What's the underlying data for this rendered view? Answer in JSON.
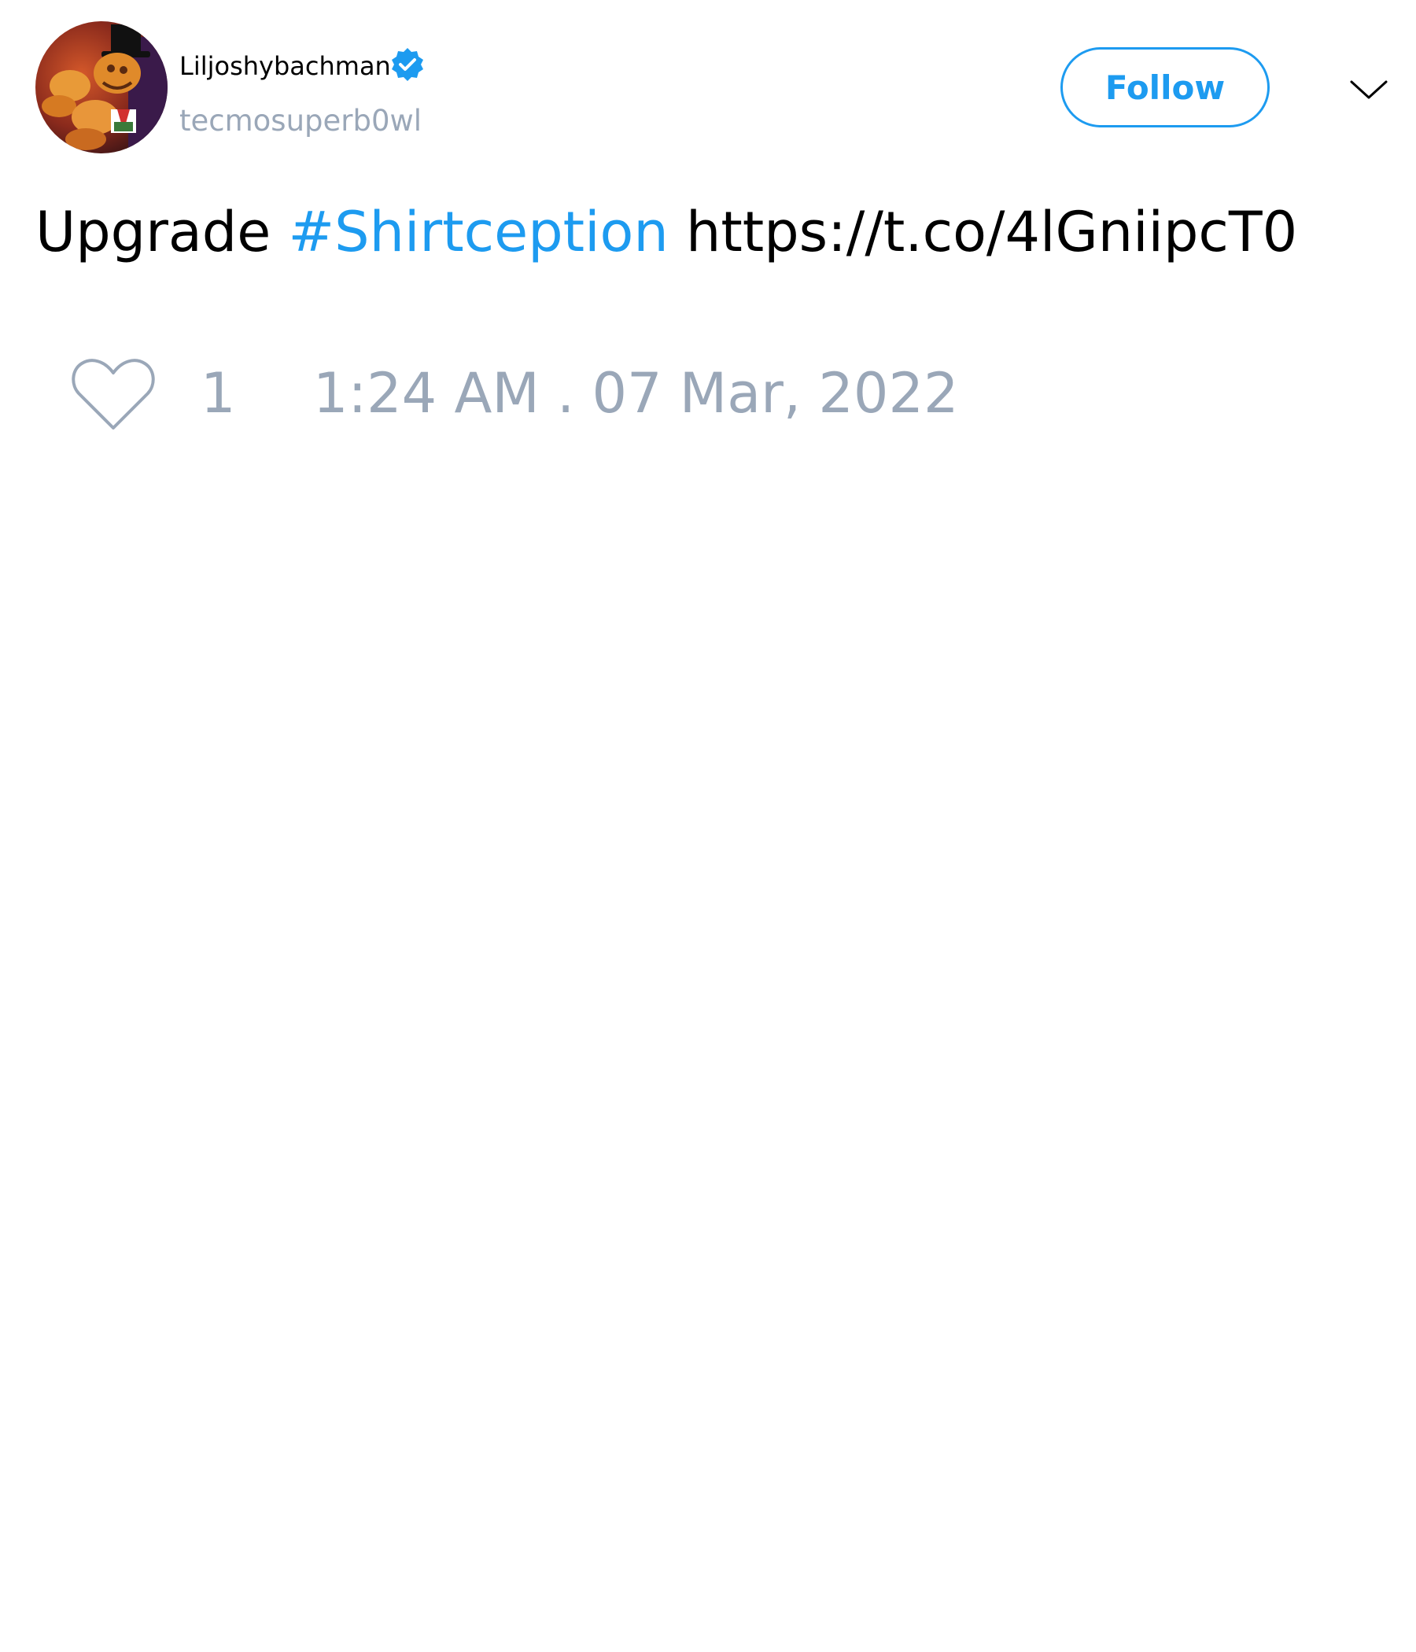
{
  "tweet": {
    "author": {
      "display_name": "Liljoshybachman",
      "handle": "tecmosuperb0wl",
      "verified_icon": "verified-badge-icon",
      "avatar_icon": "avatar-image"
    },
    "follow_label": "Follow",
    "menu_icon": "chevron-down-icon",
    "text": {
      "prefix": "Upgrade ",
      "hashtag": "#Shirtception",
      "link": " https://t.co/4lGniipcT0"
    },
    "like_icon": "heart-icon",
    "like_count": "1",
    "timestamp": "1:24 AM . 07 Mar, 2022"
  },
  "colors": {
    "accent": "#1d9bf0",
    "muted": "#9aa7b8",
    "text": "#000000",
    "background": "#ffffff"
  }
}
